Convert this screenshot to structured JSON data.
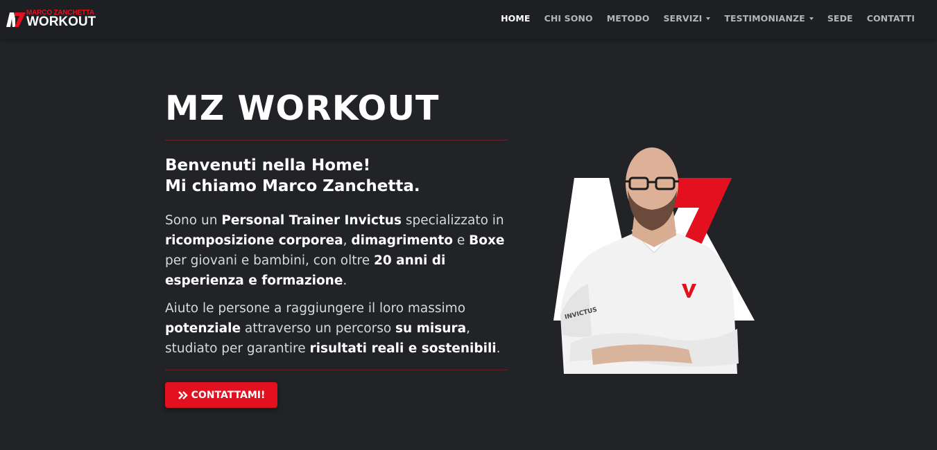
{
  "brand": {
    "top": "MARCO ZANCHETTA",
    "main": "WORKOUT",
    "logo_letters": "MZ"
  },
  "nav": {
    "items": [
      {
        "label": "HOME",
        "active": true,
        "dropdown": false
      },
      {
        "label": "CHI SONO",
        "active": false,
        "dropdown": false
      },
      {
        "label": "METODO",
        "active": false,
        "dropdown": false
      },
      {
        "label": "SERVIZI",
        "active": false,
        "dropdown": true
      },
      {
        "label": "TESTIMONIANZE",
        "active": false,
        "dropdown": true
      },
      {
        "label": "SEDE",
        "active": false,
        "dropdown": false
      },
      {
        "label": "CONTATTI",
        "active": false,
        "dropdown": false
      }
    ]
  },
  "hero": {
    "title": "MZ WORKOUT",
    "subtitle_line1": "Benvenuti nella Home!",
    "subtitle_line2": "Mi chiamo Marco Zanchetta.",
    "para1": [
      {
        "t": "Sono un ",
        "b": false
      },
      {
        "t": "Personal Trainer Invictus",
        "b": true
      },
      {
        "t": " specializzato in ",
        "b": false
      },
      {
        "t": "ricomposizione corporea",
        "b": true
      },
      {
        "t": ", ",
        "b": false
      },
      {
        "t": "dimagrimento",
        "b": true
      },
      {
        "t": " e ",
        "b": false
      },
      {
        "t": "Boxe",
        "b": true
      },
      {
        "t": " per giovani e bambini, con oltre ",
        "b": false
      },
      {
        "t": "20 anni di esperienza e formazione",
        "b": true
      },
      {
        "t": ".",
        "b": false
      }
    ],
    "para2": [
      {
        "t": "Aiuto le persone a raggiungere il loro massimo ",
        "b": false
      },
      {
        "t": "potenziale",
        "b": true
      },
      {
        "t": " attraverso un percorso ",
        "b": false
      },
      {
        "t": "su misura",
        "b": true
      },
      {
        "t": ", studiato per garantire ",
        "b": false
      },
      {
        "t": "risultati reali e sostenibili",
        "b": true
      },
      {
        "t": ".",
        "b": false
      }
    ],
    "cta_label": "CONTATTAMI!",
    "cta_icon": "double-chevron-right-icon",
    "shirt_text": "INVICTUS"
  },
  "colors": {
    "background": "#212327",
    "navbar": "#1d1f23",
    "accent": "#e3101f",
    "divider": "#6b1f26"
  }
}
